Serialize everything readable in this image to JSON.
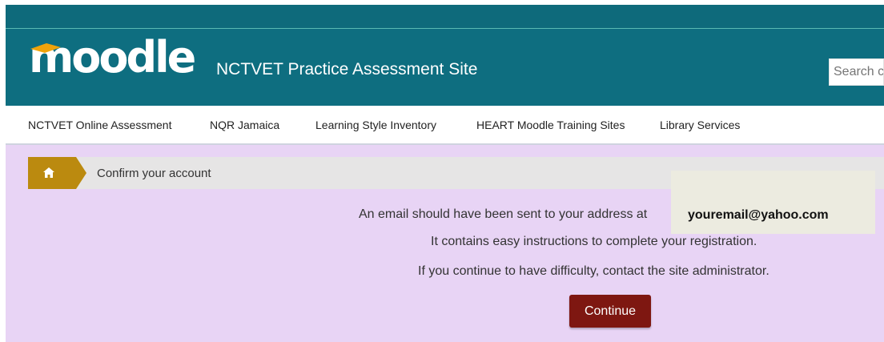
{
  "header": {
    "logo_text": "moodle",
    "site_name": "NCTVET Practice Assessment Site",
    "search_placeholder": "Search c"
  },
  "nav": {
    "items": [
      {
        "label": "NCTVET Online Assessment"
      },
      {
        "label": "NQR Jamaica"
      },
      {
        "label": "Learning Style Inventory"
      },
      {
        "label": "HEART Moodle Training Sites"
      },
      {
        "label": "Library Services"
      }
    ]
  },
  "breadcrumb": {
    "home_icon": "home-icon",
    "current": "Confirm your account"
  },
  "main": {
    "line1": "An email should have been sent to your address at",
    "email": "youremail@yahoo.com",
    "line2": "It contains easy instructions to complete your registration.",
    "line3": "If you continue to have difficulty, contact the site administrator.",
    "continue_label": "Continue"
  },
  "colors": {
    "header_bg": "#0e6e80",
    "content_bg": "#e8d4f5",
    "breadcrumb_home": "#bb8a0f",
    "button_bg": "#7e1711"
  }
}
